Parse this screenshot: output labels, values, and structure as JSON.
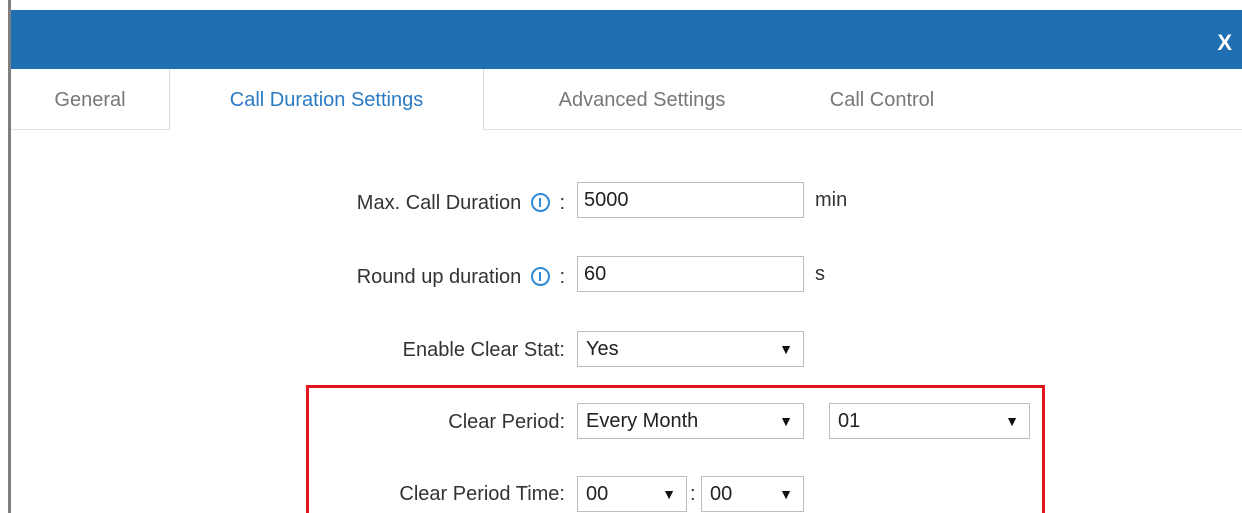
{
  "dialog": {
    "close_label": "X"
  },
  "tabs": [
    {
      "label": "General"
    },
    {
      "label": "Call Duration Settings"
    },
    {
      "label": "Advanced Settings"
    },
    {
      "label": "Call Control"
    }
  ],
  "active_tab": "Call Duration Settings",
  "form": {
    "max_call_duration": {
      "label": "Max. Call Duration",
      "colon": ":",
      "value": "5000",
      "unit": "min"
    },
    "round_up_duration": {
      "label": "Round up duration",
      "colon": ":",
      "value": "60",
      "unit": "s"
    },
    "enable_clear_stat": {
      "label": "Enable Clear Stat:",
      "value": "Yes"
    },
    "clear_period": {
      "label": "Clear Period:",
      "period_value": "Every Month",
      "day_value": "01"
    },
    "clear_period_time": {
      "label": "Clear Period Time:",
      "hour_value": "00",
      "separator": ":",
      "minute_value": "00"
    }
  },
  "icons": {
    "info": "info-icon",
    "caret": "caret-down-icon",
    "close": "close-icon"
  },
  "colors": {
    "header": "#1f6fb2",
    "active_tab": "#2b7bc4",
    "highlight_border": "#e3141d",
    "info_icon": "#2f8ad8"
  }
}
